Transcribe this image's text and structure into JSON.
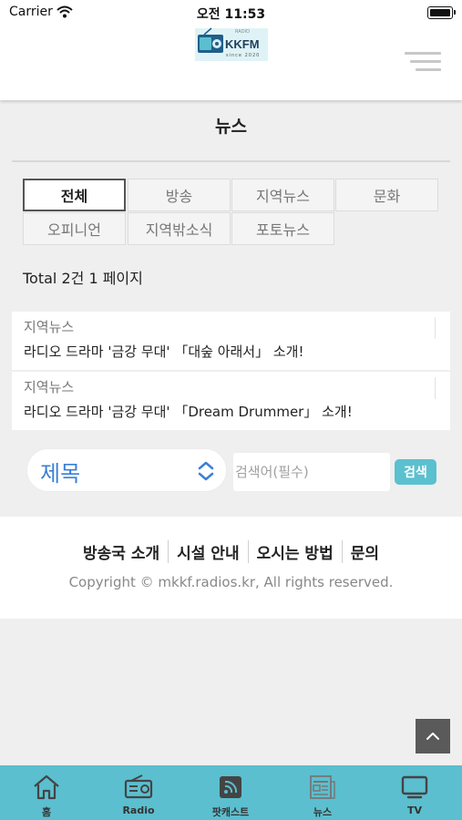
{
  "status_bar": {
    "carrier": "Carrier",
    "time": "오전 11:53"
  },
  "header": {
    "logo_text": "KKFM",
    "logo_sub": "since 2020",
    "logo_top": "RADIO"
  },
  "page": {
    "title": "뉴스",
    "tabs": [
      "전체",
      "방송",
      "지역뉴스",
      "문화",
      "오피니언",
      "지역밖소식",
      "포토뉴스"
    ],
    "active_tab": "전체",
    "total": "Total 2건 1 페이지"
  },
  "news": [
    {
      "category": "지역뉴스",
      "title": "라디오 드라마 '금강 무대' 「대숲 아래서」 소개!"
    },
    {
      "category": "지역뉴스",
      "title": "라디오 드라마 '금강 무대' 「Dream Drummer」 소개!"
    }
  ],
  "search": {
    "field_selected": "제목",
    "placeholder": "검색어(필수)",
    "button_label": "검색"
  },
  "footer": {
    "links": [
      "방송국 소개",
      "시설 안내",
      "오시는 방법",
      "문의"
    ],
    "copyright": "Copyright © mkkf.radios.kr, All rights reserved."
  },
  "bottom_nav": {
    "items": [
      {
        "label": "홈",
        "icon": "home-icon"
      },
      {
        "label": "Radio",
        "icon": "radio-icon"
      },
      {
        "label": "팟캐스트",
        "icon": "podcast-icon"
      },
      {
        "label": "뉴스",
        "icon": "news-icon"
      },
      {
        "label": "TV",
        "icon": "tv-icon"
      }
    ]
  },
  "colors": {
    "accent": "#5bbfcf",
    "select_text": "#3a7fd6"
  }
}
